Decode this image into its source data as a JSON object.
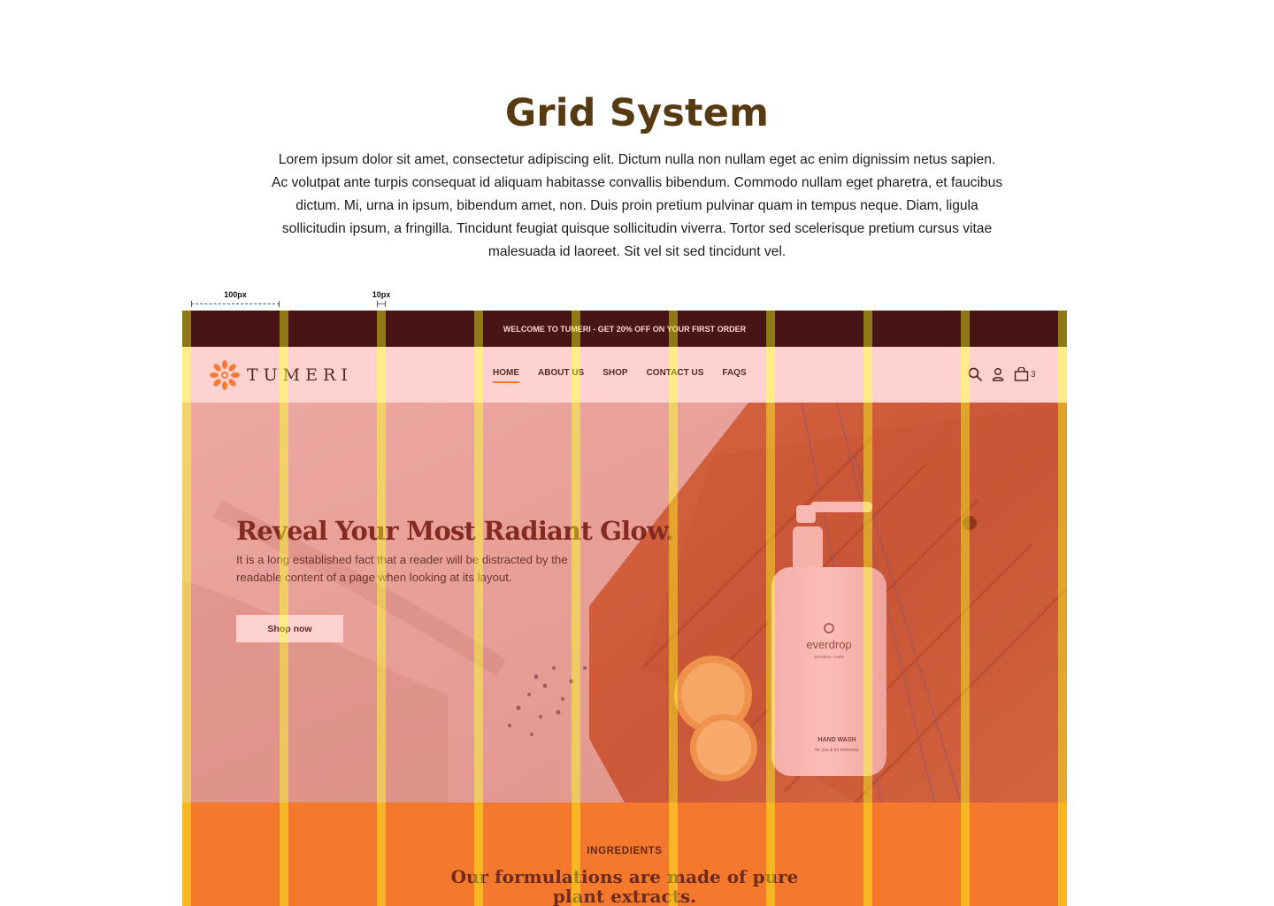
{
  "page": {
    "title": "Grid System",
    "intro": "Lorem ipsum dolor sit amet, consectetur adipiscing elit. Dictum nulla non nullam eget ac enim dignissim netus sapien. Ac volutpat ante turpis consequat id aliquam habitasse convallis bibendum. Commodo nullam eget pharetra, et faucibus dictum. Mi, urna in ipsum, bibendum amet, non. Duis proin pretium pulvinar quam in tempus neque. Diam, ligula sollicitudin ipsum, a fringilla. Tincidunt feugiat quisque sollicitudin viverra. Tortor sed scelerisque pretium cursus vitae malesuada id laoreet. Sit vel sit sed tincidunt vel."
  },
  "grid_annotations": {
    "column_width_label": "100px",
    "gutter_width_label": "10px",
    "columns": 9
  },
  "mockup": {
    "announcement": "WELCOME TO TUMERI - GET 20% OFF ON YOUR FIRST ORDER",
    "brand": {
      "name": "TUMERI",
      "logo_icon": "sunflower-mandala-icon",
      "logo_color": "#f5892b"
    },
    "nav": {
      "items": [
        {
          "label": "HOME",
          "active": true
        },
        {
          "label": "ABOUT US",
          "active": false
        },
        {
          "label": "SHOP",
          "active": false
        },
        {
          "label": "CONTACT US",
          "active": false
        },
        {
          "label": "FAQS",
          "active": false
        }
      ],
      "icons": [
        "search-icon",
        "user-icon",
        "bag-icon"
      ],
      "cart_count": "3"
    },
    "hero": {
      "title": "Reveal Your Most Radiant Glow.",
      "description": "It is a long established fact that a reader will be distracted by the readable content of a page when looking at its layout.",
      "cta": "Shop now",
      "bottle_brand": "everdrop",
      "bottle_sub": "NATURAL CARE",
      "bottle_label": "HAND WASH",
      "bottle_tagline": "for you & for tomorrow"
    },
    "ingredients": {
      "label": "INGREDIENTS",
      "heading": "Our formulations are made of pure plant extracts."
    }
  },
  "colors": {
    "title": "#553a12",
    "topbar": "#070101",
    "accent": "#f5892b",
    "ingredients_bg": "#f2881f",
    "column_overlay": "rgba(255,80,80,0.26)",
    "gutter_overlay": "rgba(255,220,40,0.55)"
  }
}
